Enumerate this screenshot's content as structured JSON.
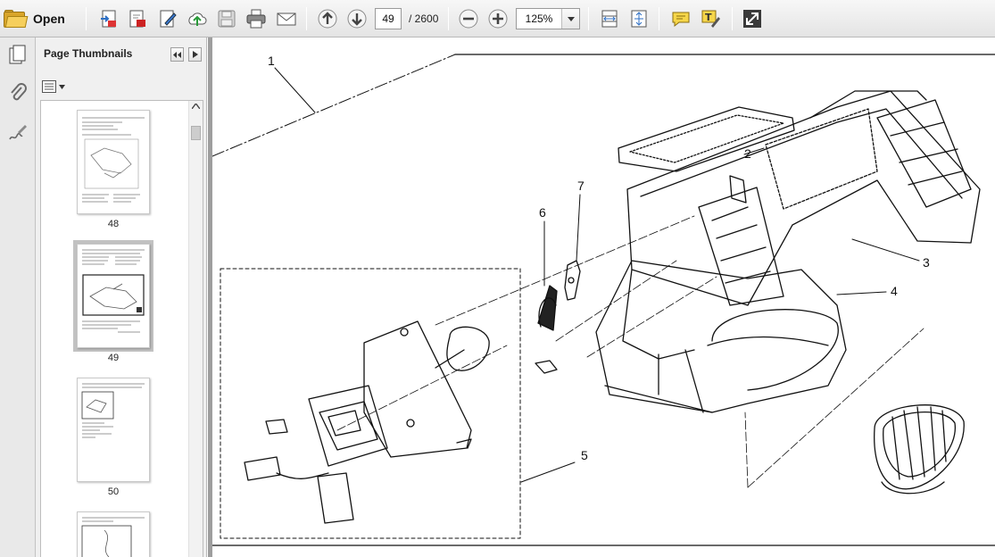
{
  "toolbar": {
    "open_label": "Open",
    "page_current": "49",
    "page_total": "/ 2600",
    "zoom_value": "125%",
    "icons": [
      "folder-open-icon",
      "create-pdf-icon",
      "edit-pdf-icon",
      "sign-icon",
      "upload-icon",
      "save-icon",
      "print-icon",
      "email-icon",
      "previous-page-icon",
      "next-page-icon",
      "zoom-out-icon",
      "zoom-in-icon",
      "fit-width-icon",
      "fit-page-icon",
      "comment-icon",
      "highlight-icon",
      "fullscreen-icon"
    ]
  },
  "sidebar": {
    "title": "Page Thumbnails",
    "thumbnails": [
      {
        "page": "48"
      },
      {
        "page": "49"
      },
      {
        "page": "50"
      }
    ]
  },
  "diagram": {
    "callouts": [
      "1",
      "2",
      "3",
      "4",
      "5",
      "6",
      "7"
    ]
  }
}
